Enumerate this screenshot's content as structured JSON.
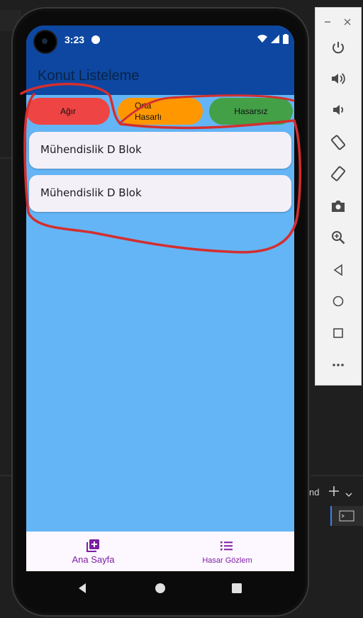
{
  "status_bar": {
    "time": "3:23",
    "icons": [
      "camera-cutout-icon",
      "app-notification-icon",
      "wifi-icon",
      "signal-icon",
      "battery-icon"
    ]
  },
  "app_bar": {
    "title": "Konut Listeleme"
  },
  "filters": [
    {
      "label": "Ağır",
      "color": "#ef4444"
    },
    {
      "label": "Orta\nHasarlı",
      "color": "#ff9800"
    },
    {
      "label": "Hasarsız",
      "color": "#43a047"
    }
  ],
  "list": {
    "items": [
      "Mühendislik D Blok",
      "Mühendislik D Blok"
    ]
  },
  "bottom_nav": {
    "items": [
      {
        "label": "Ana Sayfa",
        "icon": "add-library-icon"
      },
      {
        "label": "Hasar Gözlem",
        "icon": "list-icon"
      }
    ]
  },
  "system_nav": {
    "icons": [
      "back-icon",
      "home-icon",
      "recents-icon"
    ]
  },
  "emulator_toolbar": {
    "window_controls": [
      "minimize-icon",
      "close-icon"
    ],
    "buttons": [
      "power-icon",
      "volume-up-icon",
      "volume-down-icon",
      "rotate-left-icon",
      "rotate-right-icon",
      "screenshot-icon",
      "zoom-icon",
      "back-icon",
      "home-icon",
      "overview-icon",
      "more-icon"
    ]
  },
  "ide": {
    "fragment_text": "nd"
  },
  "colors": {
    "app_bar": "#0d47a1",
    "screen_bg": "#64b5f6",
    "accent": "#7b1fa2",
    "annotation": "#d32f2f"
  }
}
